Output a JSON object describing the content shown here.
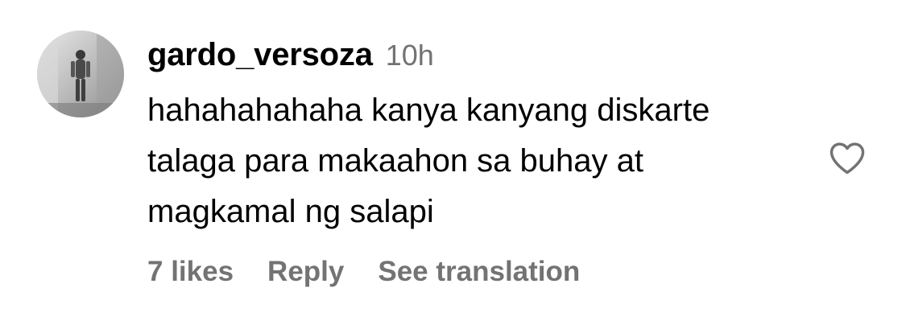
{
  "comment": {
    "username": "gardo_versoza",
    "time": "10h",
    "text": "hahahahahaha kanya kanyang diskarte\ntalaga para makaahon sa buhay at\nmagkamal ng salapi",
    "likes": "7 likes",
    "reply_label": "Reply",
    "translation_label": "See translation"
  },
  "icons": {
    "like": "heart-outline-icon"
  },
  "colors": {
    "secondary_text": "#737373",
    "primary_text": "#000000",
    "icon_stroke": "#737373"
  }
}
